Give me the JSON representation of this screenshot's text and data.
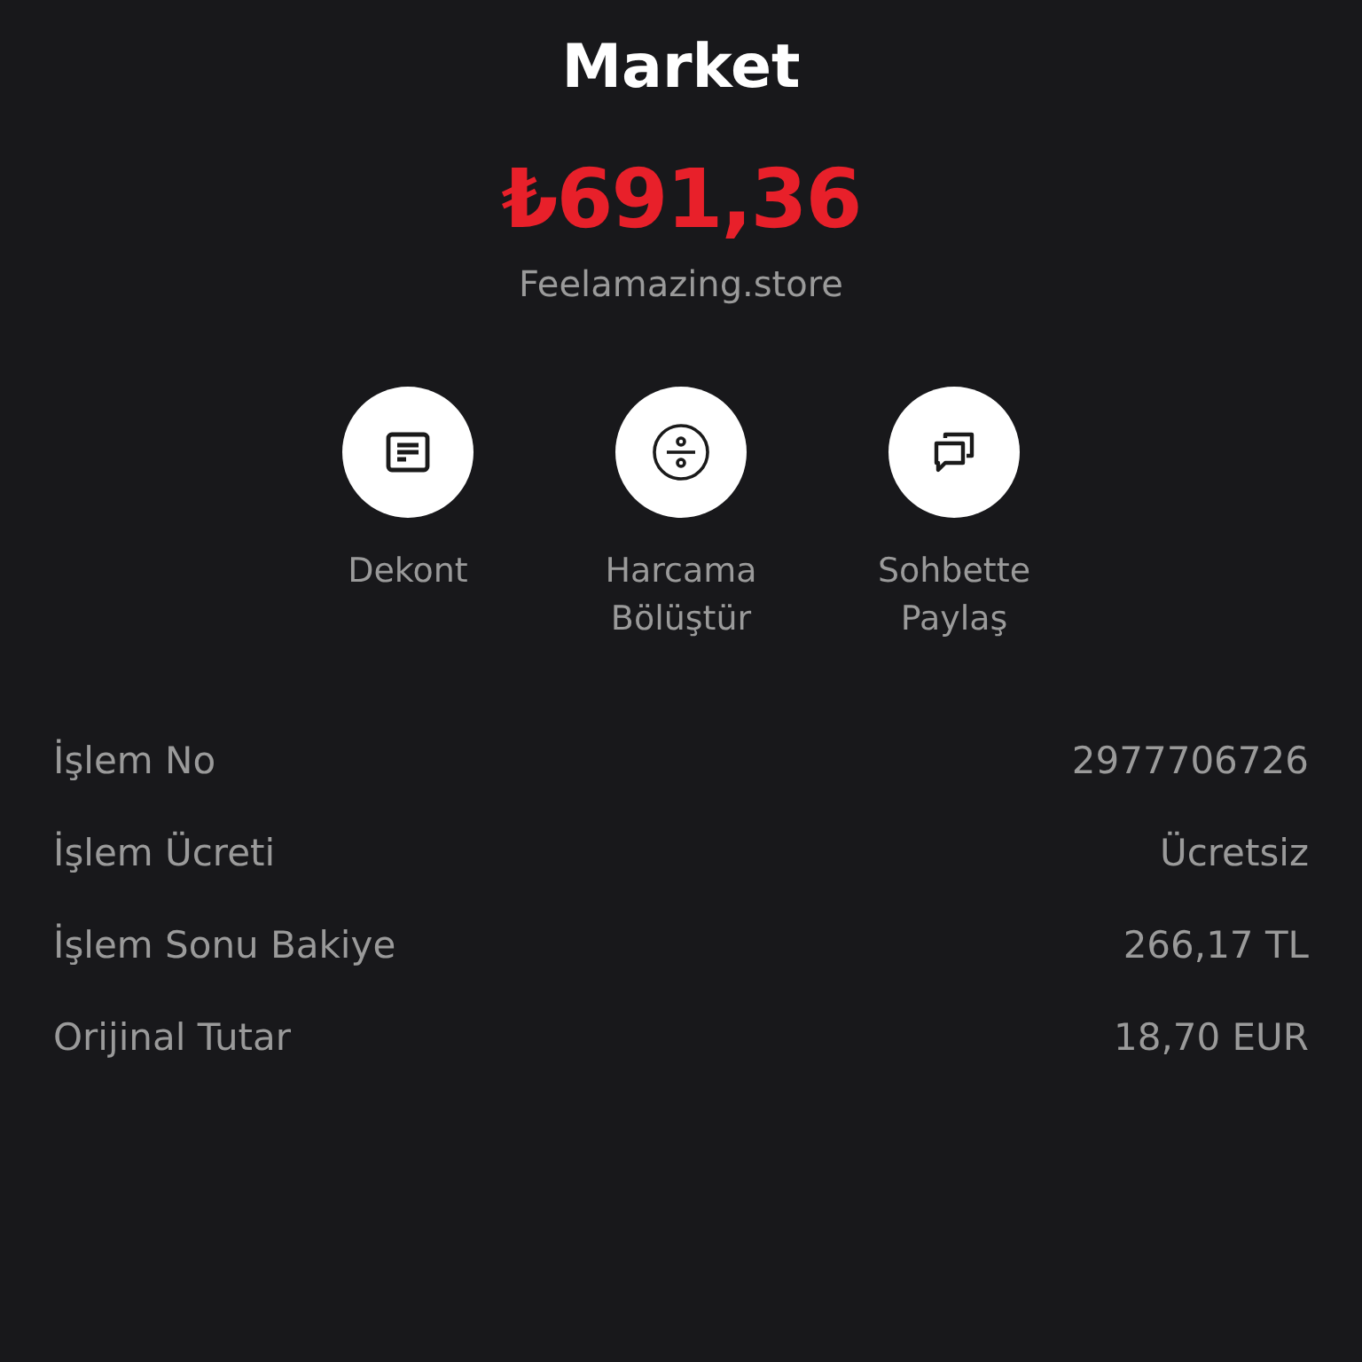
{
  "title": "Market",
  "amount": "₺691,36",
  "merchant": "Feelamazing.store",
  "actions": [
    {
      "kind": "receipt",
      "label": "Dekont"
    },
    {
      "kind": "divide",
      "label": "Harcama Bölüştür"
    },
    {
      "kind": "chat",
      "label": "Sohbette Paylaş"
    }
  ],
  "details": [
    {
      "label": "İşlem No",
      "value": "2977706726"
    },
    {
      "label": "İşlem Ücreti",
      "value": "Ücretsiz"
    },
    {
      "label": "İşlem Sonu Bakiye",
      "value": "266,17 TL"
    },
    {
      "label": "Orijinal Tutar",
      "value": "18,70 EUR"
    }
  ]
}
